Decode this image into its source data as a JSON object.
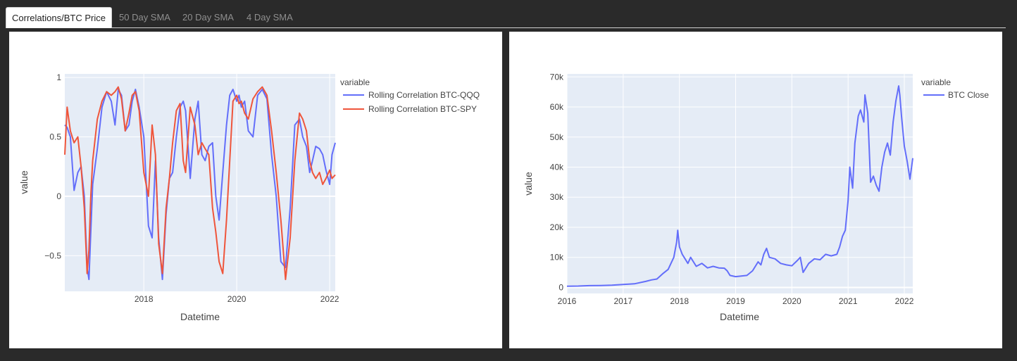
{
  "tabs": [
    {
      "label": "Correlations/BTC Price",
      "active": true
    },
    {
      "label": "50 Day SMA",
      "active": false
    },
    {
      "label": "20 Day SMA",
      "active": false
    },
    {
      "label": "4 Day SMA",
      "active": false
    }
  ],
  "colors": {
    "plot_bg": "#e5ecf6",
    "grid": "#ffffff",
    "qqq": "#636efa",
    "spy": "#ef553b",
    "btc": "#636efa"
  },
  "chart_data": [
    {
      "type": "line",
      "xlabel": "Datetime",
      "ylabel": "value",
      "xlim": [
        2016.3,
        2022.12
      ],
      "ylim": [
        -0.8,
        1.03
      ],
      "x_ticks": [
        2018,
        2020,
        2022
      ],
      "x_tick_labels": [
        "2018",
        "2020",
        "2022"
      ],
      "y_ticks": [
        -0.5,
        0,
        0.5,
        1
      ],
      "y_tick_labels": [
        "−0.5",
        "0",
        "0.5",
        "1"
      ],
      "grid": true,
      "legend": {
        "title": "variable",
        "position": "right"
      },
      "series": [
        {
          "name": "Rolling Correlation BTC-QQQ",
          "x": [
            2016.3,
            2016.35,
            2016.42,
            2016.5,
            2016.58,
            2016.65,
            2016.72,
            2016.78,
            2016.82,
            2016.86,
            2016.9,
            2017.0,
            2017.1,
            2017.2,
            2017.3,
            2017.38,
            2017.45,
            2017.52,
            2017.6,
            2017.68,
            2017.75,
            2017.82,
            2017.9,
            2018.0,
            2018.1,
            2018.18,
            2018.25,
            2018.32,
            2018.4,
            2018.48,
            2018.55,
            2018.62,
            2018.7,
            2018.78,
            2018.85,
            2018.9,
            2019.0,
            2019.1,
            2019.17,
            2019.25,
            2019.32,
            2019.4,
            2019.48,
            2019.55,
            2019.62,
            2019.7,
            2019.78,
            2019.85,
            2019.92,
            2020.0,
            2020.05,
            2020.1,
            2020.17,
            2020.25,
            2020.35,
            2020.45,
            2020.55,
            2020.65,
            2020.75,
            2020.85,
            2020.95,
            2021.05,
            2021.15,
            2021.25,
            2021.35,
            2021.42,
            2021.5,
            2021.57,
            2021.63,
            2021.7,
            2021.78,
            2021.85,
            2021.92,
            2022.0,
            2022.05,
            2022.12
          ],
          "y": [
            0.6,
            0.58,
            0.5,
            0.05,
            0.2,
            0.25,
            0.0,
            -0.6,
            -0.7,
            -0.3,
            0.1,
            0.4,
            0.75,
            0.88,
            0.8,
            0.6,
            0.9,
            0.85,
            0.55,
            0.6,
            0.8,
            0.9,
            0.75,
            0.5,
            -0.25,
            -0.35,
            0.3,
            -0.35,
            -0.7,
            -0.15,
            0.15,
            0.2,
            0.5,
            0.75,
            0.8,
            0.72,
            0.15,
            0.65,
            0.8,
            0.35,
            0.3,
            0.42,
            0.45,
            0.0,
            -0.2,
            0.2,
            0.6,
            0.85,
            0.9,
            0.8,
            0.85,
            0.75,
            0.8,
            0.55,
            0.5,
            0.85,
            0.9,
            0.82,
            0.35,
            0.0,
            -0.55,
            -0.6,
            -0.1,
            0.6,
            0.65,
            0.5,
            0.42,
            0.2,
            0.3,
            0.42,
            0.4,
            0.35,
            0.22,
            0.1,
            0.35,
            0.45
          ]
        },
        {
          "name": "Rolling Correlation BTC-SPY",
          "x": [
            2016.3,
            2016.35,
            2016.42,
            2016.5,
            2016.58,
            2016.65,
            2016.72,
            2016.78,
            2016.82,
            2016.86,
            2016.9,
            2017.0,
            2017.1,
            2017.2,
            2017.3,
            2017.38,
            2017.45,
            2017.52,
            2017.6,
            2017.68,
            2017.75,
            2017.82,
            2017.9,
            2018.0,
            2018.1,
            2018.18,
            2018.25,
            2018.32,
            2018.4,
            2018.48,
            2018.55,
            2018.62,
            2018.7,
            2018.78,
            2018.85,
            2018.9,
            2019.0,
            2019.1,
            2019.17,
            2019.25,
            2019.32,
            2019.4,
            2019.48,
            2019.55,
            2019.62,
            2019.7,
            2019.78,
            2019.85,
            2019.92,
            2020.0,
            2020.05,
            2020.1,
            2020.17,
            2020.25,
            2020.35,
            2020.45,
            2020.55,
            2020.65,
            2020.75,
            2020.85,
            2020.95,
            2021.05,
            2021.15,
            2021.25,
            2021.35,
            2021.42,
            2021.5,
            2021.57,
            2021.63,
            2021.7,
            2021.78,
            2021.85,
            2021.92,
            2022.0,
            2022.05,
            2022.12
          ],
          "y": [
            0.35,
            0.75,
            0.55,
            0.45,
            0.5,
            0.25,
            -0.1,
            -0.65,
            -0.45,
            0.0,
            0.3,
            0.65,
            0.8,
            0.88,
            0.85,
            0.88,
            0.92,
            0.82,
            0.55,
            0.7,
            0.85,
            0.88,
            0.72,
            0.2,
            0.0,
            0.6,
            0.35,
            -0.4,
            -0.65,
            -0.1,
            0.15,
            0.45,
            0.72,
            0.78,
            0.3,
            0.2,
            0.75,
            0.6,
            0.35,
            0.45,
            0.4,
            0.35,
            -0.1,
            -0.3,
            -0.55,
            -0.65,
            -0.2,
            0.3,
            0.8,
            0.85,
            0.78,
            0.8,
            0.7,
            0.65,
            0.82,
            0.88,
            0.92,
            0.85,
            0.55,
            0.2,
            -0.2,
            -0.7,
            -0.35,
            0.3,
            0.7,
            0.65,
            0.55,
            0.3,
            0.2,
            0.15,
            0.2,
            0.1,
            0.15,
            0.22,
            0.15,
            0.18
          ]
        }
      ]
    },
    {
      "type": "line",
      "xlabel": "Datetime",
      "ylabel": "value",
      "xlim": [
        2016.0,
        2022.15
      ],
      "ylim": [
        -2000,
        71000
      ],
      "x_ticks": [
        2016,
        2017,
        2018,
        2019,
        2020,
        2021,
        2022
      ],
      "x_tick_labels": [
        "2016",
        "2017",
        "2018",
        "2019",
        "2020",
        "2021",
        "2022"
      ],
      "y_ticks": [
        0,
        10000,
        20000,
        30000,
        40000,
        50000,
        60000,
        70000
      ],
      "y_tick_labels": [
        "0",
        "10k",
        "20k",
        "30k",
        "40k",
        "50k",
        "60k",
        "70k"
      ],
      "grid": true,
      "legend": {
        "title": "variable",
        "position": "right"
      },
      "series": [
        {
          "name": "BTC Close",
          "x": [
            2016.0,
            2016.2,
            2016.4,
            2016.6,
            2016.8,
            2017.0,
            2017.2,
            2017.4,
            2017.5,
            2017.6,
            2017.7,
            2017.8,
            2017.9,
            2017.95,
            2017.97,
            2018.0,
            2018.05,
            2018.1,
            2018.15,
            2018.2,
            2018.3,
            2018.4,
            2018.5,
            2018.6,
            2018.7,
            2018.8,
            2018.85,
            2018.9,
            2019.0,
            2019.1,
            2019.2,
            2019.3,
            2019.4,
            2019.45,
            2019.5,
            2019.55,
            2019.6,
            2019.7,
            2019.8,
            2019.9,
            2020.0,
            2020.1,
            2020.15,
            2020.2,
            2020.3,
            2020.4,
            2020.5,
            2020.6,
            2020.7,
            2020.8,
            2020.85,
            2020.9,
            2020.95,
            2021.0,
            2021.03,
            2021.08,
            2021.12,
            2021.18,
            2021.22,
            2021.28,
            2021.3,
            2021.35,
            2021.4,
            2021.45,
            2021.5,
            2021.55,
            2021.6,
            2021.65,
            2021.7,
            2021.75,
            2021.8,
            2021.85,
            2021.9,
            2021.92,
            2021.95,
            2022.0,
            2022.05,
            2022.1,
            2022.15
          ],
          "y": [
            400,
            450,
            600,
            650,
            750,
            1000,
            1200,
            2000,
            2500,
            2800,
            4500,
            6000,
            10000,
            15000,
            19000,
            13500,
            11000,
            9500,
            8000,
            10000,
            7000,
            8000,
            6500,
            7000,
            6500,
            6400,
            5500,
            4000,
            3600,
            3800,
            4000,
            5500,
            8500,
            7500,
            11000,
            13000,
            10000,
            9500,
            8000,
            7500,
            7200,
            9000,
            10000,
            5000,
            8000,
            9500,
            9200,
            11000,
            10500,
            11000,
            13500,
            17000,
            19000,
            29000,
            40000,
            33000,
            48000,
            57000,
            59000,
            55000,
            64000,
            58000,
            35000,
            37000,
            34000,
            32000,
            40000,
            45000,
            48000,
            44000,
            55000,
            62000,
            67000,
            64000,
            57000,
            47000,
            42000,
            36000,
            43000
          ]
        }
      ]
    }
  ]
}
